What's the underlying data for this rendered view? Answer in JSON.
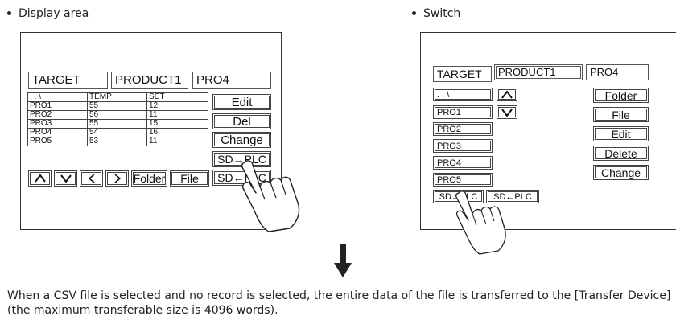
{
  "display_area": {
    "heading": "Display area",
    "fields": [
      "TARGET",
      "PRODUCT1",
      "PRO4"
    ],
    "table": {
      "headers": [
        ". . \\",
        "TEMP",
        "SET"
      ],
      "rows": [
        [
          "PRO1",
          "55",
          "12"
        ],
        [
          "PRO2",
          "56",
          "11"
        ],
        [
          "PRO3",
          "55",
          "15"
        ],
        [
          "PRO4",
          "54",
          "16"
        ],
        [
          "PRO5",
          "53",
          "11"
        ]
      ]
    },
    "side_buttons": [
      "Edit",
      "Del",
      "Change",
      "SD→PLC",
      "SD←PLC"
    ],
    "nav_buttons": [
      "^",
      "v",
      "<",
      ">"
    ],
    "folder_label": "Folder",
    "file_label": "File"
  },
  "switch": {
    "heading": "Switch",
    "fields": [
      "TARGET",
      "PRODUCT1",
      "PRO4"
    ],
    "list": [
      ". . \\",
      "PRO1",
      "PRO2",
      "PRO3",
      "PRO4",
      "PRO5"
    ],
    "right_buttons": [
      "Folder",
      "File",
      "Edit",
      "Delete",
      "Change"
    ],
    "bottom_buttons": [
      "SD→PLC",
      "SD←PLC"
    ]
  },
  "caption": "When a CSV file is selected and no record is selected, the entire data of the file is transferred to the [Transfer Device] (the maximum transferable size is 4096 words).",
  "icons": {
    "bullet": "bullet-icon",
    "arrow": "arrow-down-icon",
    "hand": "pointing-hand-icon"
  }
}
